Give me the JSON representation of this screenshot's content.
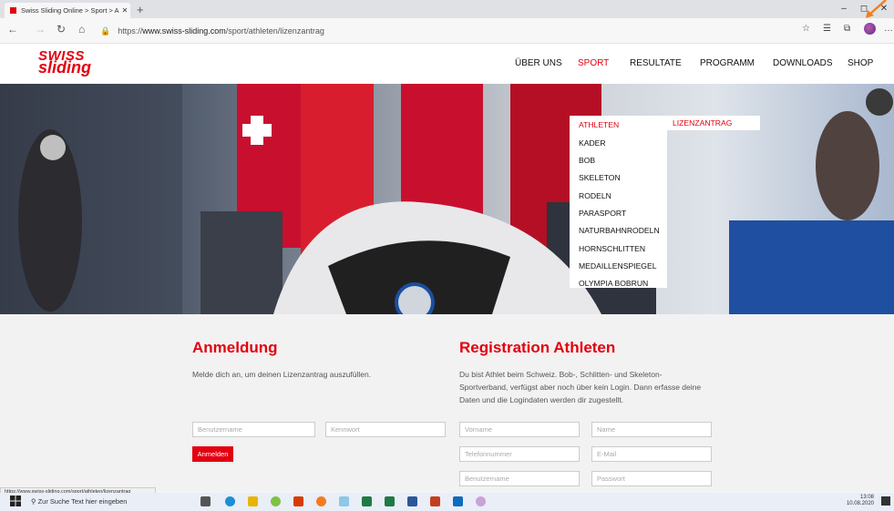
{
  "browser": {
    "tab_title": "Swiss Sliding Online > Sport > A",
    "tab_close": "✕",
    "new_tab": "+",
    "window_controls": [
      "–",
      "◻",
      "✕"
    ],
    "url_prefix": "https://",
    "url_domain": "www.swiss-sliding.com",
    "url_path": "/sport/athleten/lizenzantrag",
    "status_url": "https://www.swiss-sliding.com/sport/athleten/lizenzantrag",
    "accent_color": "#e3000f"
  },
  "site": {
    "logo_line1": "SWISS",
    "logo_line2": "sliding",
    "nav": [
      "ÜBER UNS",
      "SPORT",
      "RESULTATE",
      "PROGRAMM",
      "DOWNLOADS",
      "SHOP"
    ],
    "dropdown": [
      "ATHLETEN",
      "KADER",
      "BOB",
      "SKELETON",
      "RODELN",
      "PARASPORT",
      "NATURBAHNRODELN",
      "HORNSCHLITTEN",
      "MEDAILLENSPIEGEL",
      "OLYMPIA BOBRUN"
    ],
    "sub_dropdown": "LIZENZANTRAG"
  },
  "login": {
    "heading": "Anmeldung",
    "text": "Melde dich an, um deinen Lizenzantrag auszufüllen.",
    "username_placeholder": "Benutzername",
    "password_placeholder": "Kennwort",
    "button": "Anmelden"
  },
  "registration": {
    "heading": "Registration Athleten",
    "text": "Du bist Athlet beim Schweiz. Bob-, Schlitten- und Skeleton-Sportverband, verfügst aber noch über kein Login. Dann erfasse deine Daten und die Logindaten werden dir zugestellt.",
    "first_name": "Vorname",
    "last_name": "Name",
    "phone": "Telefonnummer",
    "email": "E-Mail",
    "username": "Benutzername",
    "password": "Passwort"
  },
  "taskbar": {
    "search_placeholder": "Zur Suche Text hier eingeben",
    "time": "13:08",
    "date": "10.08.2020"
  }
}
